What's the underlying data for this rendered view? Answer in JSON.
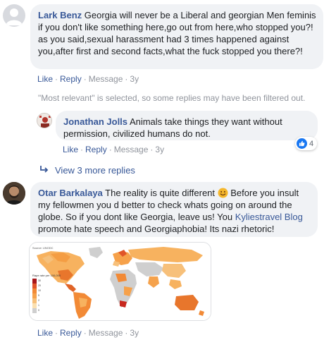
{
  "comment1": {
    "author": "Lark Benz",
    "text": "Georgia will never be a Liberal and georgian Men feminised...",
    "text_lines": [
      "if you don't like something here,go out from here,who stopped you?!",
      "as you said,sexual harassment had 3 times happened against",
      "you,after first and second facts,what the fuck stopped you there?!"
    ],
    "actions": {
      "like": "Like",
      "reply": "Reply",
      "message": "Message",
      "time": "3y"
    }
  },
  "filter_note": "\"Most relevant\" is selected, so some replies may have been filtered out.",
  "reply1": {
    "author": "Jonathan Jolls",
    "text": "Animals take things they want without permission, civilized humans do not.",
    "reaction_count": "4",
    "actions": {
      "like": "Like",
      "reply": "Reply",
      "message": "Message",
      "time": "3y"
    }
  },
  "view_more": "View 3 more replies",
  "comment2": {
    "author": "Otar Barkalaya",
    "text_before_emoji": "The reality is quite different",
    "text_after_emoji": "Before you insult my fellowmen you d better to check whats going on around the globe. So if you dont like Georgia, leave us! You",
    "mention": "Kyliestravel Blog",
    "text_end": "promote hate speech and Georgiaphobia! Its nazi rhetoric!",
    "actions": {
      "like": "Like",
      "reply": "Reply",
      "message": "Message",
      "time": "3y"
    }
  },
  "map_image": {
    "source": "Source: UNODC",
    "legend_title": "Rape rate per 100,000",
    "legend_values": [
      "30",
      "20",
      "10",
      "5",
      "2",
      "1",
      "0"
    ]
  },
  "colors": {
    "link": "#385898",
    "bubble": "#f0f2f5",
    "muted": "#90949c",
    "like_blue": "#1877f2"
  }
}
